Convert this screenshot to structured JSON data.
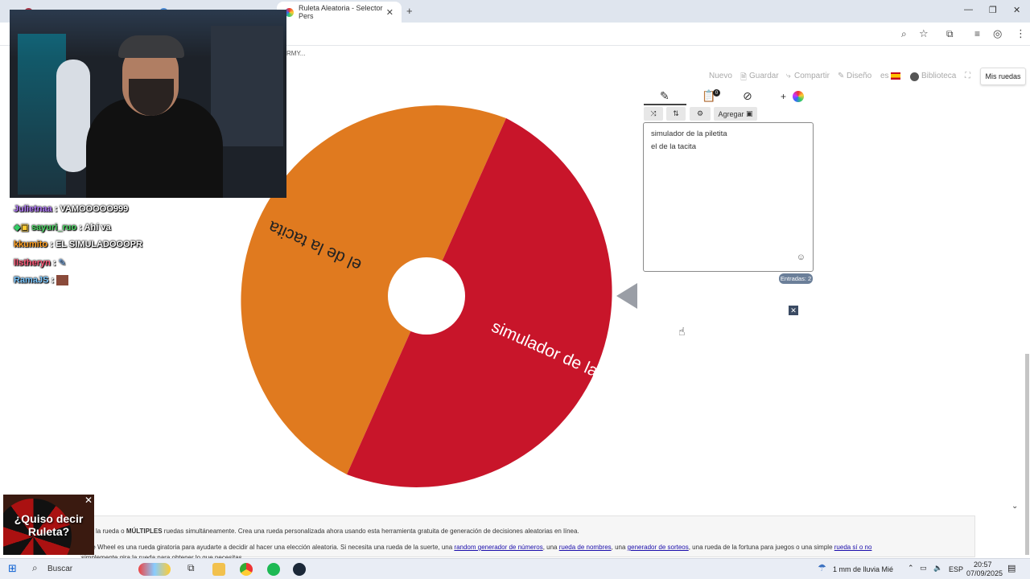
{
  "browser": {
    "tabs": [
      {
        "label": "Ruleta Aleatoria - Selector Pers",
        "active": true
      }
    ],
    "new_tab": "+",
    "bookmark_text": "RMY..."
  },
  "page_nav": {
    "nuevo": "Nuevo",
    "guardar": "Guardar",
    "compartir": "Compartir",
    "diseno": "Diseño",
    "lang": "es",
    "biblioteca": "Biblioteca",
    "mis_ruedas": "Mis ruedas"
  },
  "wheel": {
    "segments": [
      {
        "label": "el de la tacita",
        "color": "#e07a1f"
      },
      {
        "label": "simulador de la p...",
        "color": "#c8152a"
      }
    ]
  },
  "editor": {
    "agregar": "Agregar",
    "entries": [
      "simulador de la piletita",
      "el de la tacita"
    ],
    "count_label": "Entradas: 2",
    "badge": "0"
  },
  "chat": [
    {
      "user": "Julietnaa",
      "msg": "VAMOOOOO999",
      "color": "#b57cff"
    },
    {
      "user": "sayuri_ruo",
      "msg": "Ahí va",
      "color": "#4cd964"
    },
    {
      "user": "kkumito",
      "msg": "EL SIMULADOOOPR",
      "color": "#ff9e1f"
    },
    {
      "user": "llstheryn",
      "msg": "",
      "color": "#ff5a7a"
    },
    {
      "user": "RamaJS",
      "msg": "",
      "color": "#7cc8ff"
    }
  ],
  "ad": {
    "line1": "¿Quiso decir",
    "line2": "Ruleta?"
  },
  "info": {
    "line1_a": "la rueda o ",
    "line1_b": "MÚLTIPLES",
    "line1_c": " ruedas simultáneamente. Crea una rueda personalizada ahora usando esta herramienta gratuita de generación de decisiones aleatorias en línea.",
    "line2_a": "n the Wheel es una rueda giratoria para ayudarte a decidir al hacer una elección aleatoria. Si necesita una rueda de la suerte, una ",
    "link1": "random generador de números",
    "line2_b": ", una ",
    "link2": "rueda de nombres",
    "line2_c": ", una ",
    "link3": "generador de sorteos",
    "line2_d": ", una rueda de la fortuna para juegos o una simple ",
    "link4": "rueda sí o no",
    "line3": "simplemente gira la rueda para obtener lo que necesitas."
  },
  "taskbar": {
    "search": "Buscar",
    "weather": "1 mm de lluvia Mié",
    "lang": "ESP",
    "time": "20:57",
    "date": "07/09/2025"
  }
}
